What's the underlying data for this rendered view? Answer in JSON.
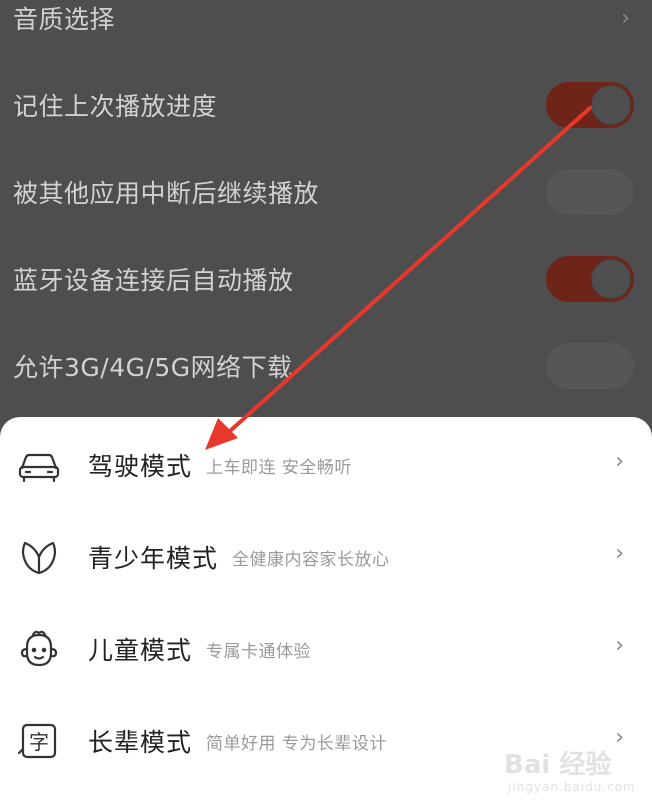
{
  "settings": {
    "rows": [
      {
        "label": "音质选择",
        "control": "chevron",
        "chevron": "›"
      },
      {
        "label": "记住上次播放进度",
        "control": "toggle",
        "on": true
      },
      {
        "label": "被其他应用中断后继续播放",
        "control": "toggle",
        "on": false
      },
      {
        "label": "蓝牙设备连接后自动播放",
        "control": "toggle",
        "on": true
      },
      {
        "label": "允许3G/4G/5G网络下载",
        "control": "toggle",
        "on": false
      }
    ]
  },
  "modes": {
    "items": [
      {
        "title": "驾驶模式",
        "desc": "上车即连  安全畅听",
        "icon": "car-icon",
        "chevron": "›"
      },
      {
        "title": "青少年模式",
        "desc": "全健康内容家长放心",
        "icon": "leaf-icon",
        "chevron": "›"
      },
      {
        "title": "儿童模式",
        "desc": "专属卡通体验",
        "icon": "child-face-icon",
        "chevron": "›"
      },
      {
        "title": "长辈模式",
        "desc": "简单好用  专为长辈设计",
        "icon": "zi-character-icon",
        "icon_char": "字",
        "chevron": "›"
      }
    ]
  },
  "annotation": {
    "color": "#e8372c",
    "icon": "red-arrow"
  },
  "watermark": {
    "text": "Bai 经验",
    "sub": "jingyan.baidu.com"
  },
  "colors": {
    "toggle_on": "#6e2419",
    "overlay": "#4e4e4e",
    "sheet": "#ffffff"
  }
}
